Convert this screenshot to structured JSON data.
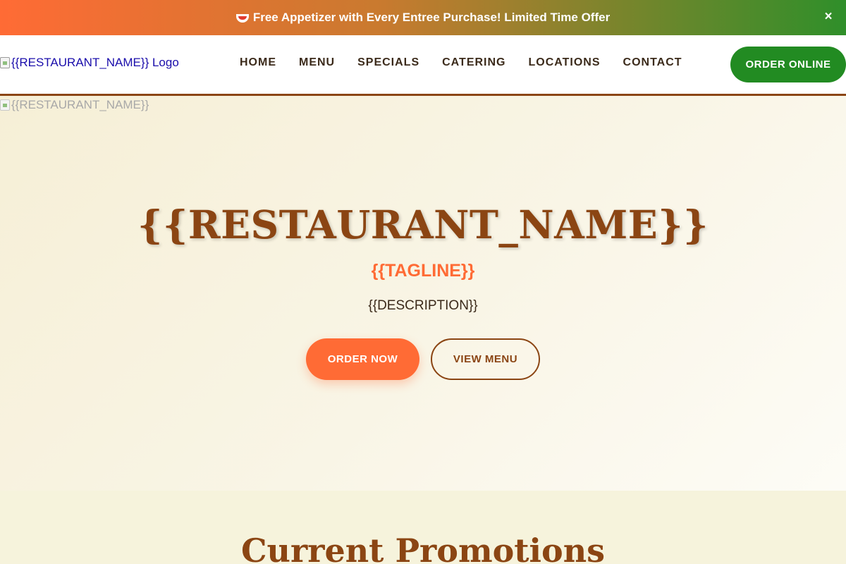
{
  "colors": {
    "primary": "#8b4513",
    "accent": "#ff6b35",
    "green": "#228b22",
    "hero_bg": "#f6efd6"
  },
  "promo_bar": {
    "icon": "cooking-pot-icon",
    "text": "Free Appetizer with Every Entree Purchase! Limited Time Offer",
    "close_label": "×"
  },
  "header": {
    "logo_alt": "{{RESTAURANT_NAME}} Logo",
    "nav": [
      "HOME",
      "MENU",
      "SPECIALS",
      "CATERING",
      "LOCATIONS",
      "CONTACT"
    ],
    "cta": "ORDER ONLINE"
  },
  "hero": {
    "image_alt": "{{RESTAURANT_NAME}}",
    "title": "{{RESTAURANT_NAME}}",
    "tagline": "{{TAGLINE}}",
    "description": "{{DESCRIPTION}}",
    "primary_button": "ORDER NOW",
    "secondary_button": "VIEW MENU"
  },
  "promotions": {
    "title": "Current Promotions"
  }
}
